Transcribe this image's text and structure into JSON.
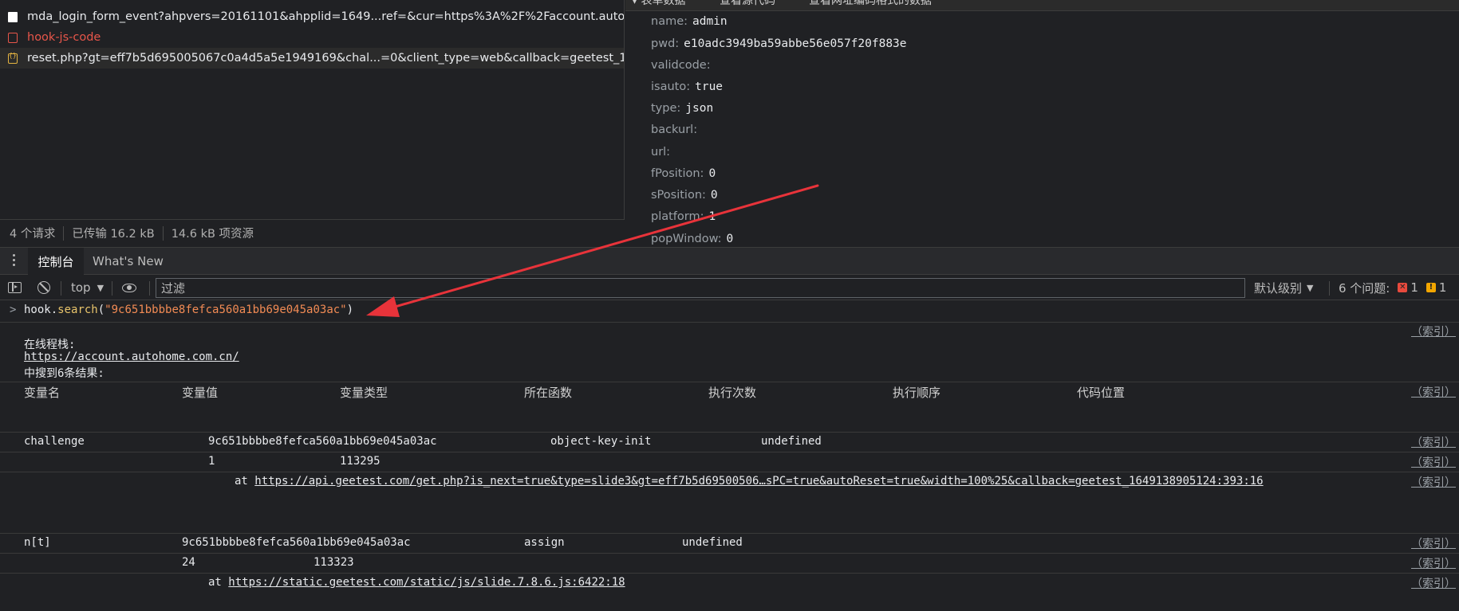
{
  "network": {
    "requests": [
      {
        "name": "mda_login_form_event?ahpvers=20161101&ahpplid=1649...ref=&cur=https%3A%2F%2Faccount.autohome.co...",
        "icon": "document-icon"
      },
      {
        "name": "hook-js-code",
        "icon": "error-document-icon"
      },
      {
        "name": "reset.php?gt=eff7b5d695005067c0a4d5a5e1949169&chal...=0&client_type=web&callback=geetest_16491389...",
        "icon": "script-icon"
      }
    ],
    "summary": {
      "requests": "4 个请求",
      "transferred": "已传输 16.2 kB",
      "resources": "14.6 kB 项资源"
    }
  },
  "payload": {
    "header_tabs": [
      "▾ 表单数据",
      "查看源代码",
      "查看网址编码格式的数据"
    ],
    "fields": [
      {
        "key": "name:",
        "value": "admin"
      },
      {
        "key": "pwd:",
        "value": "e10adc3949ba59abbe56e057f20f883e"
      },
      {
        "key": "validcode:",
        "value": ""
      },
      {
        "key": "isauto:",
        "value": "true"
      },
      {
        "key": "type:",
        "value": "json"
      },
      {
        "key": "backurl:",
        "value": ""
      },
      {
        "key": "url:",
        "value": ""
      },
      {
        "key": "fPosition:",
        "value": "0"
      },
      {
        "key": "sPosition:",
        "value": "0"
      },
      {
        "key": "platform:",
        "value": "1"
      },
      {
        "key": "popWindow:",
        "value": "0"
      }
    ]
  },
  "drawer": {
    "tab_console": "控制台",
    "tab_whats_new": "What's New"
  },
  "toolbar": {
    "context": "top",
    "filter_placeholder": "过滤",
    "level": "默认级别",
    "issues_label": "6 个问题:",
    "errors": "1",
    "warnings": "1"
  },
  "console": {
    "command": {
      "prompt": ">",
      "object": "hook",
      "dot": ".",
      "method": "search",
      "open": "(",
      "arg": "\"9c651bbbbe8fefca560a1bb69e045a03ac\"",
      "close": ")"
    },
    "index_label": "（索引）",
    "intro": {
      "line1": "在线程栈:",
      "url": "https://account.autohome.com.cn/",
      "line3": "中搜到6条结果:"
    },
    "columns": [
      "变量名",
      "变量值",
      "变量类型",
      "所在函数",
      "执行次数",
      "执行顺序",
      "代码位置"
    ],
    "results": [
      {
        "name": "challenge",
        "value": "9c651bbbbe8fefca560a1bb69e045a03ac",
        "func": "object-key-init",
        "type": "undefined",
        "count": "1",
        "order": "113295",
        "at": "at",
        "location": "https://api.geetest.com/get.php?is_next=true&type=slide3&gt=eff7b5d69500506…sPC=true&autoReset=true&width=100%25&callback=geetest_1649138905124:393:16"
      },
      {
        "name": "n[t]",
        "value": "9c651bbbbe8fefca560a1bb69e045a03ac",
        "func": "assign",
        "type": "undefined",
        "count": "24",
        "order": "113323",
        "at": "at",
        "location": "https://static.geetest.com/static/js/slide.7.8.6.js:6422:18"
      }
    ]
  },
  "colors": {
    "background": "#202124",
    "accent_red": "#e8333a",
    "string": "#f28b54"
  }
}
